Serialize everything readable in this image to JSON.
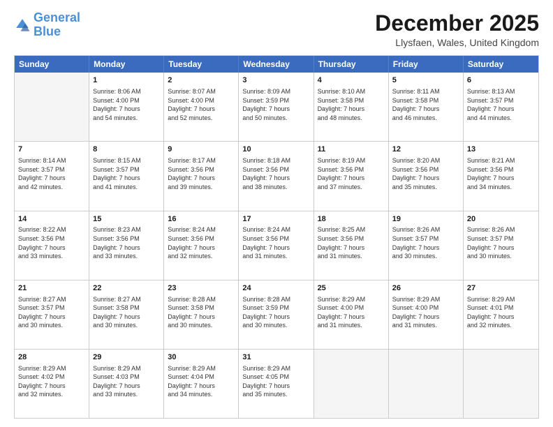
{
  "logo": {
    "line1": "General",
    "line2": "Blue"
  },
  "title": "December 2025",
  "location": "Llysfaen, Wales, United Kingdom",
  "days_header": [
    "Sunday",
    "Monday",
    "Tuesday",
    "Wednesday",
    "Thursday",
    "Friday",
    "Saturday"
  ],
  "weeks": [
    [
      {
        "day": "",
        "info": ""
      },
      {
        "day": "1",
        "info": "Sunrise: 8:06 AM\nSunset: 4:00 PM\nDaylight: 7 hours\nand 54 minutes."
      },
      {
        "day": "2",
        "info": "Sunrise: 8:07 AM\nSunset: 4:00 PM\nDaylight: 7 hours\nand 52 minutes."
      },
      {
        "day": "3",
        "info": "Sunrise: 8:09 AM\nSunset: 3:59 PM\nDaylight: 7 hours\nand 50 minutes."
      },
      {
        "day": "4",
        "info": "Sunrise: 8:10 AM\nSunset: 3:58 PM\nDaylight: 7 hours\nand 48 minutes."
      },
      {
        "day": "5",
        "info": "Sunrise: 8:11 AM\nSunset: 3:58 PM\nDaylight: 7 hours\nand 46 minutes."
      },
      {
        "day": "6",
        "info": "Sunrise: 8:13 AM\nSunset: 3:57 PM\nDaylight: 7 hours\nand 44 minutes."
      }
    ],
    [
      {
        "day": "7",
        "info": "Sunrise: 8:14 AM\nSunset: 3:57 PM\nDaylight: 7 hours\nand 42 minutes."
      },
      {
        "day": "8",
        "info": "Sunrise: 8:15 AM\nSunset: 3:57 PM\nDaylight: 7 hours\nand 41 minutes."
      },
      {
        "day": "9",
        "info": "Sunrise: 8:17 AM\nSunset: 3:56 PM\nDaylight: 7 hours\nand 39 minutes."
      },
      {
        "day": "10",
        "info": "Sunrise: 8:18 AM\nSunset: 3:56 PM\nDaylight: 7 hours\nand 38 minutes."
      },
      {
        "day": "11",
        "info": "Sunrise: 8:19 AM\nSunset: 3:56 PM\nDaylight: 7 hours\nand 37 minutes."
      },
      {
        "day": "12",
        "info": "Sunrise: 8:20 AM\nSunset: 3:56 PM\nDaylight: 7 hours\nand 35 minutes."
      },
      {
        "day": "13",
        "info": "Sunrise: 8:21 AM\nSunset: 3:56 PM\nDaylight: 7 hours\nand 34 minutes."
      }
    ],
    [
      {
        "day": "14",
        "info": "Sunrise: 8:22 AM\nSunset: 3:56 PM\nDaylight: 7 hours\nand 33 minutes."
      },
      {
        "day": "15",
        "info": "Sunrise: 8:23 AM\nSunset: 3:56 PM\nDaylight: 7 hours\nand 33 minutes."
      },
      {
        "day": "16",
        "info": "Sunrise: 8:24 AM\nSunset: 3:56 PM\nDaylight: 7 hours\nand 32 minutes."
      },
      {
        "day": "17",
        "info": "Sunrise: 8:24 AM\nSunset: 3:56 PM\nDaylight: 7 hours\nand 31 minutes."
      },
      {
        "day": "18",
        "info": "Sunrise: 8:25 AM\nSunset: 3:56 PM\nDaylight: 7 hours\nand 31 minutes."
      },
      {
        "day": "19",
        "info": "Sunrise: 8:26 AM\nSunset: 3:57 PM\nDaylight: 7 hours\nand 30 minutes."
      },
      {
        "day": "20",
        "info": "Sunrise: 8:26 AM\nSunset: 3:57 PM\nDaylight: 7 hours\nand 30 minutes."
      }
    ],
    [
      {
        "day": "21",
        "info": "Sunrise: 8:27 AM\nSunset: 3:57 PM\nDaylight: 7 hours\nand 30 minutes."
      },
      {
        "day": "22",
        "info": "Sunrise: 8:27 AM\nSunset: 3:58 PM\nDaylight: 7 hours\nand 30 minutes."
      },
      {
        "day": "23",
        "info": "Sunrise: 8:28 AM\nSunset: 3:58 PM\nDaylight: 7 hours\nand 30 minutes."
      },
      {
        "day": "24",
        "info": "Sunrise: 8:28 AM\nSunset: 3:59 PM\nDaylight: 7 hours\nand 30 minutes."
      },
      {
        "day": "25",
        "info": "Sunrise: 8:29 AM\nSunset: 4:00 PM\nDaylight: 7 hours\nand 31 minutes."
      },
      {
        "day": "26",
        "info": "Sunrise: 8:29 AM\nSunset: 4:00 PM\nDaylight: 7 hours\nand 31 minutes."
      },
      {
        "day": "27",
        "info": "Sunrise: 8:29 AM\nSunset: 4:01 PM\nDaylight: 7 hours\nand 32 minutes."
      }
    ],
    [
      {
        "day": "28",
        "info": "Sunrise: 8:29 AM\nSunset: 4:02 PM\nDaylight: 7 hours\nand 32 minutes."
      },
      {
        "day": "29",
        "info": "Sunrise: 8:29 AM\nSunset: 4:03 PM\nDaylight: 7 hours\nand 33 minutes."
      },
      {
        "day": "30",
        "info": "Sunrise: 8:29 AM\nSunset: 4:04 PM\nDaylight: 7 hours\nand 34 minutes."
      },
      {
        "day": "31",
        "info": "Sunrise: 8:29 AM\nSunset: 4:05 PM\nDaylight: 7 hours\nand 35 minutes."
      },
      {
        "day": "",
        "info": ""
      },
      {
        "day": "",
        "info": ""
      },
      {
        "day": "",
        "info": ""
      }
    ]
  ]
}
